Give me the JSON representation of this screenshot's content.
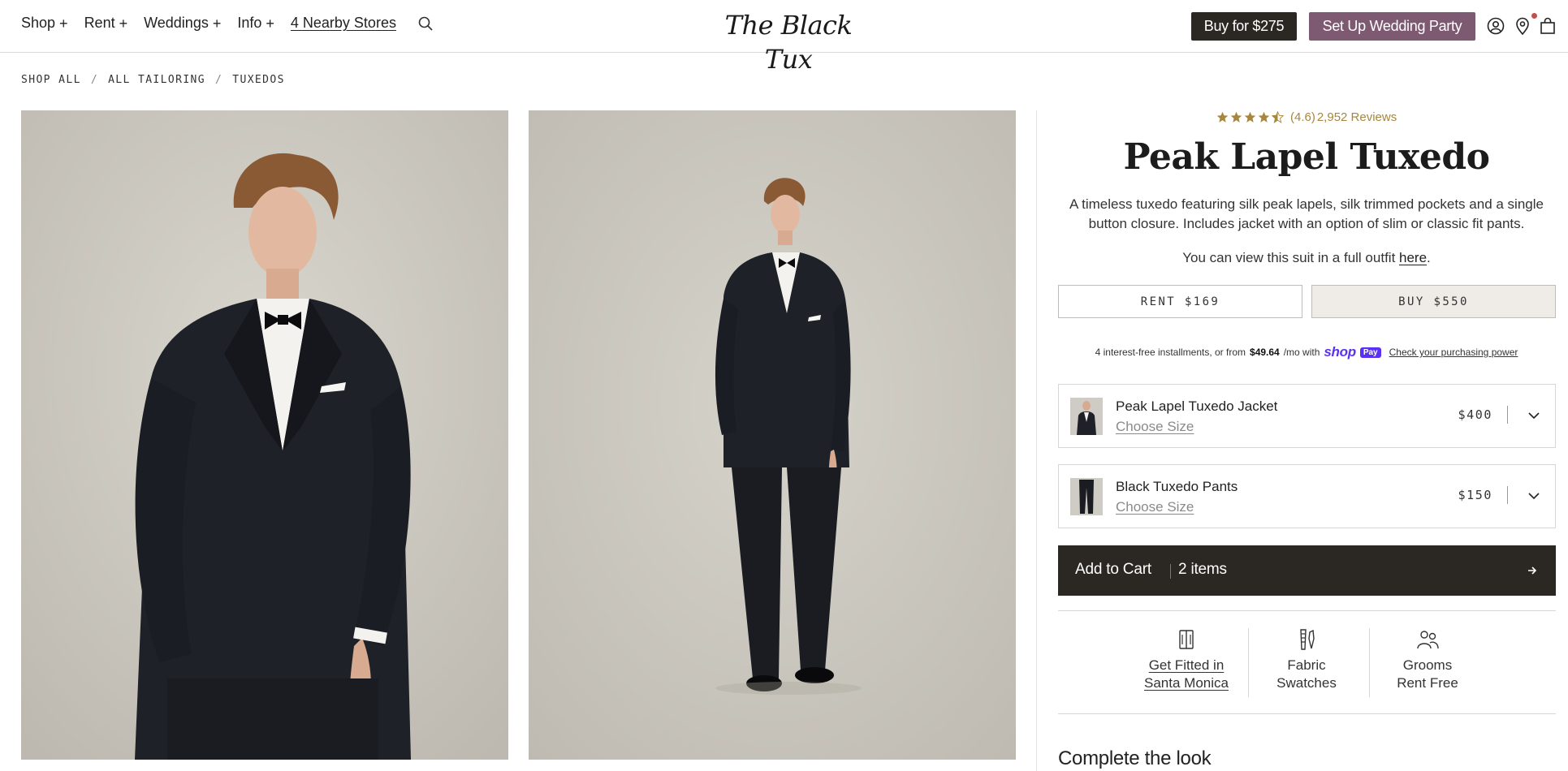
{
  "header": {
    "nav": [
      {
        "label": "Shop",
        "icon": "plus-icon"
      },
      {
        "label": "Rent",
        "icon": "plus-icon"
      },
      {
        "label": "Weddings",
        "icon": "plus-icon"
      },
      {
        "label": "Info",
        "icon": "plus-icon"
      }
    ],
    "stores_link": "4 Nearby Stores",
    "logo_text": "The Black Tux",
    "buy_button": "Buy for $275",
    "wedding_button": "Set Up Wedding Party",
    "icons": [
      "search-icon",
      "account-icon",
      "location-icon",
      "bag-icon"
    ]
  },
  "breadcrumb": [
    "SHOP ALL",
    "ALL TAILORING",
    "TUXEDOS"
  ],
  "breadcrumb_sep": "/",
  "product": {
    "rating": 4.6,
    "rating_text": "(4.6)",
    "reviews_text": "2,952 Reviews",
    "title": "Peak Lapel Tuxedo",
    "description": "A timeless tuxedo featuring silk peak lapels, silk trimmed pockets and a single button closure. Includes jacket with an option of slim or classic fit pants.",
    "outfit_prefix": "You can view this suit in a full outfit ",
    "outfit_link": "here",
    "outfit_suffix": ".",
    "rent_label": "RENT $169",
    "buy_label": "BUY $550",
    "shoppay": {
      "prefix": "4 interest-free installments, or from",
      "amount": "$49.64",
      "suffix": "/mo with",
      "brand": "shop",
      "badge": "Pay",
      "link": "Check your purchasing power"
    },
    "items": [
      {
        "name": "Peak Lapel Tuxedo Jacket",
        "size_link": "Choose Size",
        "price": "$400"
      },
      {
        "name": "Black Tuxedo Pants",
        "size_link": "Choose Size",
        "price": "$150"
      }
    ],
    "cart": {
      "label": "Add to Cart",
      "items": "2 items"
    },
    "features": [
      {
        "line1": "Get Fitted in",
        "line2": "Santa Monica",
        "icon": "hanger-fitting-icon"
      },
      {
        "line1": "Fabric",
        "line2": "Swatches",
        "icon": "fabric-swatch-icon"
      },
      {
        "line1": "Grooms",
        "line2": "Rent Free",
        "icon": "people-icon"
      }
    ],
    "complete_look": "Complete the look"
  },
  "colors": {
    "brand_dark": "#2b2722",
    "brand_mauve": "#7e5a72",
    "star_gold": "#a6873d",
    "shoppay_purple": "#5a31f4"
  }
}
